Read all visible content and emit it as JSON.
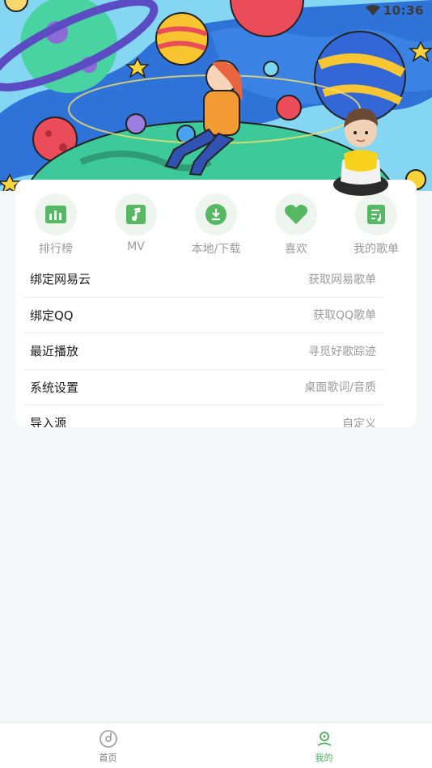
{
  "status_bar": {
    "time": "10:36"
  },
  "quick_actions": [
    {
      "label": "排行榜",
      "icon": "chart-bars-icon"
    },
    {
      "label": "MV",
      "icon": "music-note-icon"
    },
    {
      "label": "本地/下载",
      "icon": "download-icon"
    },
    {
      "label": "喜欢",
      "icon": "heart-icon"
    },
    {
      "label": "我的歌单",
      "icon": "playlist-icon"
    }
  ],
  "menu": [
    {
      "title": "绑定网易云",
      "subtitle": "获取网易歌单"
    },
    {
      "title": "绑定QQ",
      "subtitle": "获取QQ歌单"
    },
    {
      "title": "最近播放",
      "subtitle": "寻觅好歌踪迹"
    },
    {
      "title": "系统设置",
      "subtitle": "桌面歌词/音质"
    },
    {
      "title": "导入源",
      "subtitle": "自定义"
    }
  ],
  "tabs": [
    {
      "label": "首页",
      "icon": "disc-icon",
      "active": false
    },
    {
      "label": "我的",
      "icon": "user-icon",
      "active": true
    }
  ],
  "colors": {
    "accent": "#4cae58",
    "icon_bg": "#eef5ee",
    "icon_green": "#57b864"
  }
}
